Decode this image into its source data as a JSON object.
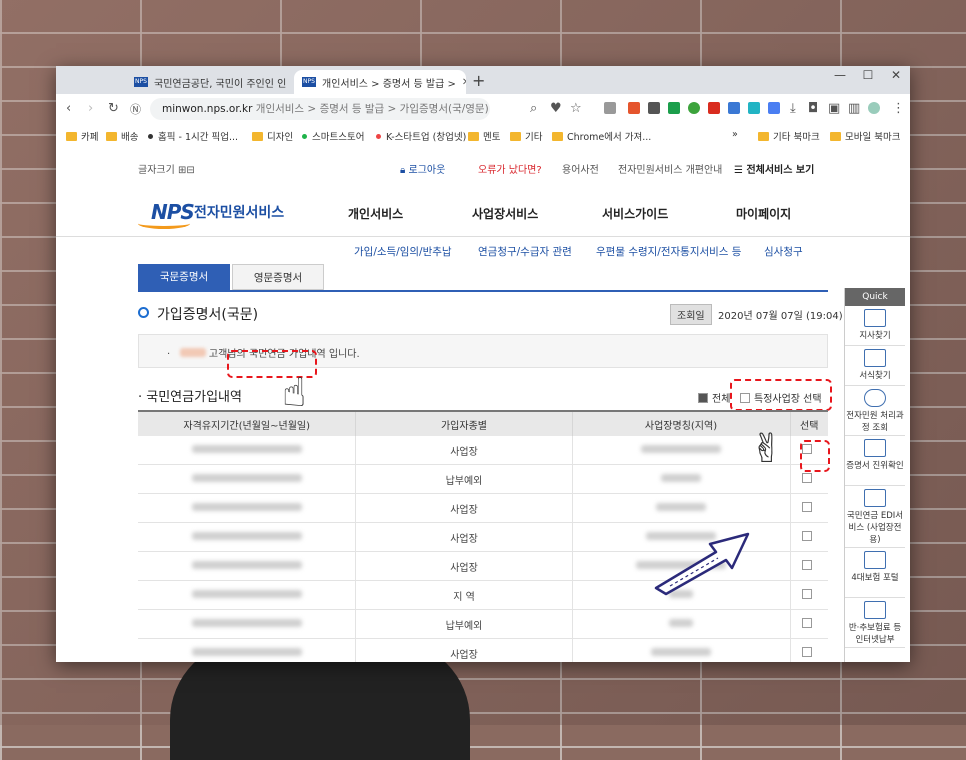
{
  "browser": {
    "tabs": [
      {
        "title": "국민연금공단, 국민이 주인인 인"
      },
      {
        "title": "개인서비스 > 증명서 등 발급 >"
      }
    ],
    "new_tab": "+",
    "url_domain": "minwon.nps.or.kr",
    "url_path": "개인서비스 > 증명서 등 발급 > 가입증명서(국/영문) -",
    "bookmarks": [
      "카페",
      "배송",
      "홈픽 - 1시간 픽업...",
      "디자인",
      "스마트스토어",
      "K-스타트업 (창업넷)",
      "멘토",
      "기타",
      "Chrome에서 가져..."
    ],
    "bookmarks_overflow": "»",
    "bookmarks_right": [
      "기타 북마크",
      "모바일 북마크"
    ]
  },
  "header": {
    "font_size_label": "글자크기",
    "logout": "로그아웃",
    "error_link": "오류가 났다면?",
    "glossary": "용어사전",
    "renewal_info": "전자민원서비스 개편안내",
    "all_services": "전체서비스 보기",
    "logo_mark": "NPS",
    "logo_text": "전자민원서비스"
  },
  "gnb": [
    "개인서비스",
    "사업장서비스",
    "서비스가이드",
    "마이페이지"
  ],
  "subnav": [
    "가입/소득/임의/반추납",
    "연금청구/수급자 관련",
    "우편물 수령지/전자통지서비스 등",
    "심사청구"
  ],
  "tabs": {
    "korean": "국문증명서",
    "english": "영문증명서"
  },
  "page": {
    "title": "가입증명서(국문)",
    "query_label": "조회일",
    "query_date": "2020년 07월 07일 (19:04)",
    "notice_before": "고객님의",
    "notice_highlight": "국민연금 가입내역",
    "notice_after": "입니다.",
    "section_title": "국민연금가입내역",
    "opt_all": "전체",
    "opt_specific": "특정사업장 선택"
  },
  "table": {
    "headers": [
      "자격유지기간(년월일~년월일)",
      "가입자종별",
      "사업장명칭(지역)",
      "선택"
    ],
    "rows": [
      {
        "type": "사업장"
      },
      {
        "type": "납부예외"
      },
      {
        "type": "사업장"
      },
      {
        "type": "사업장"
      },
      {
        "type": "사업장"
      },
      {
        "type": "지 역"
      },
      {
        "type": "납부예외"
      },
      {
        "type": "사업장"
      }
    ]
  },
  "quick": {
    "title": "Quick",
    "items": [
      "지사찾기",
      "서식찾기",
      "전자민원 처리과정 조회",
      "증명서 진위확인",
      "국민연금 EDI서비스 (사업장전용)",
      "4대보험 포털",
      "반·추보험료 등 인터넷납부"
    ]
  },
  "colors": {
    "brand": "#1c4fa3",
    "tab_active": "#2f5fb5",
    "highlight": "#e8161c",
    "orange": "#f39a1c"
  }
}
